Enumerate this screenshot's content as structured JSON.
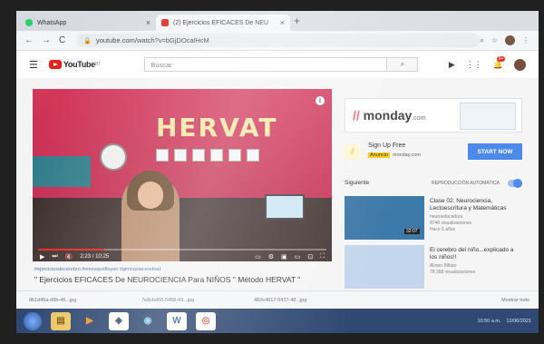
{
  "browser": {
    "tabs": [
      {
        "label": "WhatsApp"
      },
      {
        "label": "(2) Ejercicios EFICACES De NEU"
      }
    ],
    "url": "youtube.com/watch?v=bGjDOcalHcM",
    "colors": {
      "whatsapp": "#25d366",
      "youtube": "#e62117"
    }
  },
  "youtube": {
    "logo_text": "YouTube",
    "logo_country": "BT",
    "search_placeholder": "Buscar",
    "notification_count": "9+"
  },
  "video": {
    "overlay_title": "HERVAT",
    "time": "2:23 / 10:25",
    "progress": 0.23,
    "hashtags": "#ejerciciosdecerebro #ninosquefluyen #gimnasiacerebral",
    "title": "\" Ejercicios EFICACES De NEUROCIENCIA Para NIÑOS \" Método HERVAT \""
  },
  "sidebar": {
    "ad": {
      "brand": "monday",
      "suffix": ".com"
    },
    "sponsor": {
      "title": "Sign Up Free",
      "tag": "Anuncio",
      "domain": "monday.com",
      "button": "START NOW"
    },
    "next_label": "Siguiente",
    "autoplay_label": "REPRODUCCIÓN AUTOMÁTICA",
    "recommendations": [
      {
        "title": "Clase 02: Neurociencia, Lectoescritura y Matemáticas",
        "channel": "neuroeducadora",
        "views": "8740 visualizaciones",
        "age": "Hace 5 años",
        "duration": "32:07"
      },
      {
        "title": "El cerebro del niño...explicado a los niños!!",
        "channel": "Alvaro Bilbao",
        "views": "78.368 visualizaciones",
        "age": "",
        "duration": ""
      }
    ]
  },
  "downloads": {
    "items": [
      {
        "name": "9b1d45a-d9b-46...jpg"
      },
      {
        "name": "7e8cbd60-5458-43...jpg"
      },
      {
        "name": "482e4817-5437-48...jpg"
      }
    ],
    "show_all": "Mostrar todo"
  },
  "taskbar": {
    "apps": [
      "explorer",
      "media",
      "store",
      "chrome-like",
      "word",
      "chrome"
    ],
    "clock": "10:50 a.m.",
    "date": "12/06/2021"
  }
}
